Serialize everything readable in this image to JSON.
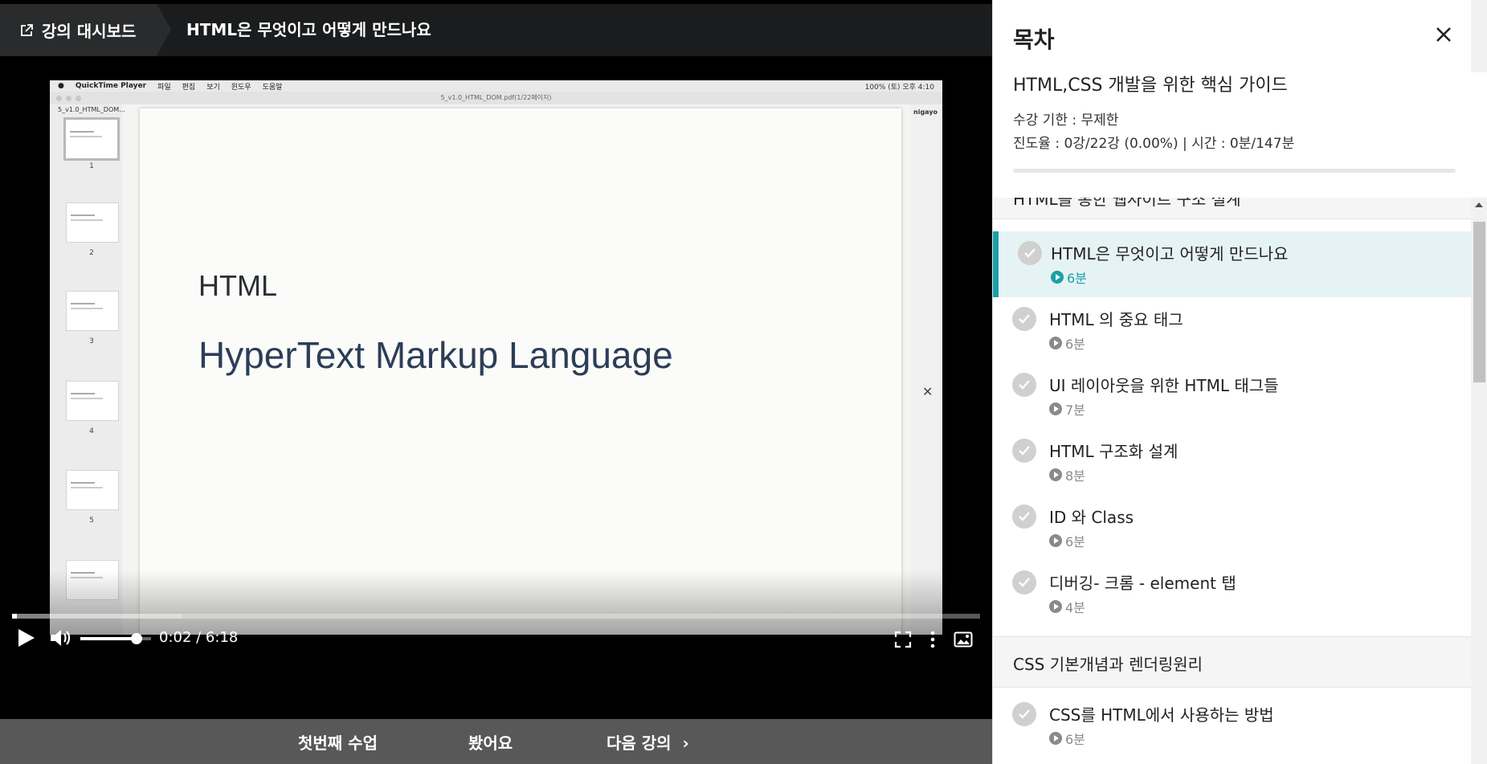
{
  "header": {
    "dashboard_label": "강의 대시보드",
    "lesson_title": "HTML은 무엇이고 어떻게 만드나요"
  },
  "slide": {
    "menubar": {
      "app": "QuickTime Player",
      "menus": [
        "파일",
        "편집",
        "보기",
        "윈도우",
        "도움말"
      ],
      "status": "100%   (토) 오후 4:10"
    },
    "window_title": "5_v1.0_HTML_DOM.pdf(1/22페이지)",
    "sidebar_header": "5_v1.0_HTML_DOM...",
    "thumb_numbers": [
      "1",
      "2",
      "3",
      "4",
      "5"
    ],
    "user": "nigayo",
    "heading": "HTML",
    "subheading": "HyperText Markup Language"
  },
  "player": {
    "progress": 0.005,
    "buffered": 0.175,
    "volume": 0.8,
    "time": "0:02 / 6:18"
  },
  "bottom_nav": {
    "first": "첫번째 수업",
    "watched": "봤어요",
    "next": "다음 강의"
  },
  "toc": {
    "title": "목차",
    "course_title": "HTML,CSS 개발을 위한 핵심 가이드",
    "period": "수강 기한 : 무제한",
    "progress_text": "진도율 : 0강/22강 (0.00%) | 시간 : 0분/147분",
    "progress_value": 0,
    "section1": "HTML을 통한 웹사이트 구조 설계",
    "section1_items": [
      {
        "title": "HTML은 무엇이고 어떻게 만드나요",
        "duration": "6분"
      },
      {
        "title": "HTML 의 중요 태그",
        "duration": "6분"
      },
      {
        "title": "UI 레이아웃을 위한 HTML 태그들",
        "duration": "7분"
      },
      {
        "title": "HTML 구조화 설계",
        "duration": "8분"
      },
      {
        "title": "ID 와 Class",
        "duration": "6분"
      },
      {
        "title": "디버깅- 크롬 - element 탭",
        "duration": "4분"
      }
    ],
    "section2": "CSS 기본개념과 렌더링원리",
    "section2_items": [
      {
        "title": "CSS를 HTML에서 사용하는 방법",
        "duration": "6분"
      }
    ]
  },
  "colors": {
    "accent": "#1aa0a6",
    "active_bg": "#e6f3f4",
    "progress_green": "#1dc078"
  }
}
